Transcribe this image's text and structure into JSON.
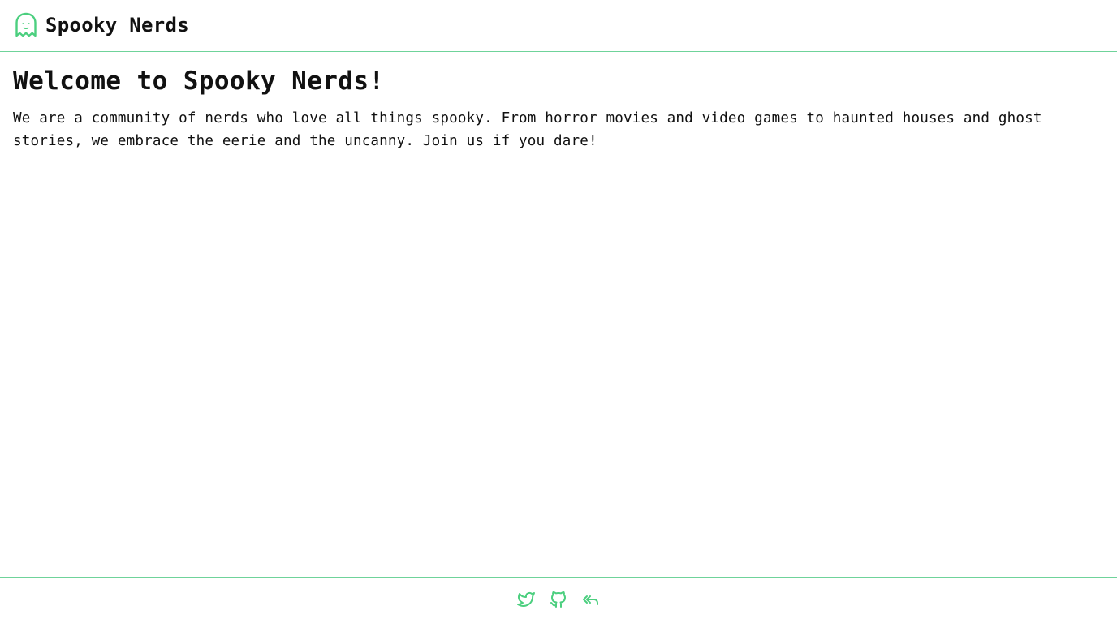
{
  "header": {
    "site_name": "Spooky Nerds",
    "logo_icon": "ghost-icon"
  },
  "main": {
    "heading": "Welcome to Spooky Nerds!",
    "intro": "We are a community of nerds who love all things spooky. From horror movies and video games to haunted houses and ghost stories, we embrace the eerie and the uncanny. Join us if you dare!"
  },
  "footer": {
    "links": [
      {
        "icon": "twitter-icon"
      },
      {
        "icon": "github-icon"
      },
      {
        "icon": "reply-all-icon"
      }
    ]
  },
  "colors": {
    "accent": "#4ccf7f",
    "divider": "#6fd39a",
    "text": "#111111",
    "background": "#ffffff"
  }
}
